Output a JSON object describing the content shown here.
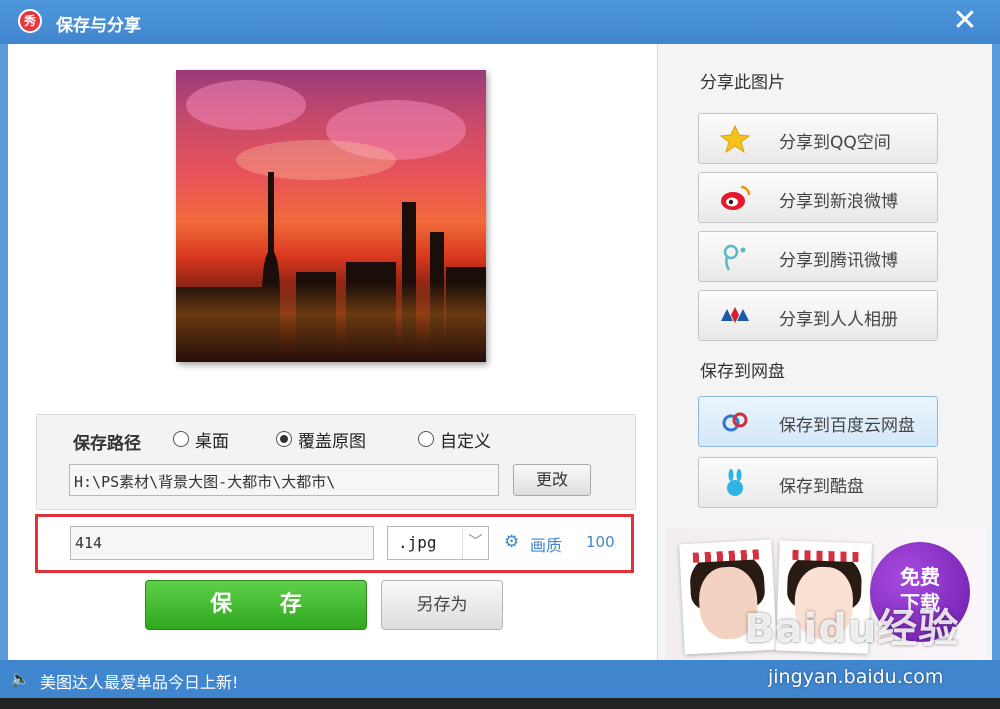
{
  "window": {
    "title": "保存与分享",
    "app_logo": "秀",
    "close_glyph": "✕"
  },
  "save_path": {
    "label": "保存路径",
    "options": [
      {
        "label": "桌面",
        "selected": false
      },
      {
        "label": "覆盖原图",
        "selected": true
      },
      {
        "label": "自定义",
        "selected": false
      }
    ],
    "path_value": "H:\\PS素材\\背景大图-大都市\\大都市\\",
    "change_label": "更改"
  },
  "file": {
    "name_value": "414",
    "format_value": ".jpg",
    "quality_label": "画质",
    "quality_value": "100"
  },
  "actions": {
    "save_label": "保 存",
    "save_as_label": "另存为"
  },
  "share": {
    "section_title": "分享此图片",
    "items": [
      {
        "label": "分享到QQ空间",
        "icon": "qzone-star-icon"
      },
      {
        "label": "分享到新浪微博",
        "icon": "sina-weibo-icon"
      },
      {
        "label": "分享到腾讯微博",
        "icon": "tencent-weibo-icon"
      },
      {
        "label": "分享到人人相册",
        "icon": "renren-icon"
      }
    ]
  },
  "cloud": {
    "section_title": "保存到网盘",
    "items": [
      {
        "label": "保存到百度云网盘",
        "icon": "baidu-cloud-icon",
        "active": true
      },
      {
        "label": "保存到酷盘",
        "icon": "kupan-rabbit-icon",
        "active": false
      }
    ]
  },
  "ad": {
    "badge_line1": "免费",
    "badge_line2": "下载"
  },
  "status": {
    "text": "美图达人最爱单品今日上新!"
  },
  "watermark": {
    "logo": "Baidu经验",
    "url": "jingyan.baidu.com"
  },
  "colors": {
    "title_bar": "#3f86cf",
    "save_green": "#2fa81f",
    "highlight_red": "#e0323a",
    "link_blue": "#3f86cf"
  }
}
